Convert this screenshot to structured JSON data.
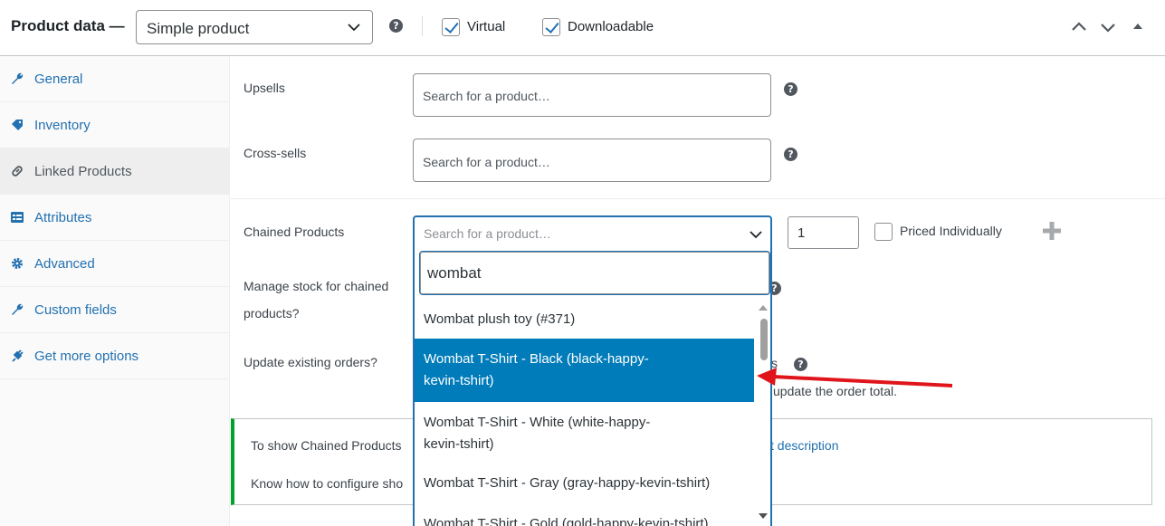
{
  "header": {
    "title": "Product data —",
    "product_type": "Simple product",
    "virtual_label": "Virtual",
    "virtual_checked": true,
    "downloadable_label": "Downloadable",
    "downloadable_checked": true,
    "help_glyph": "?"
  },
  "sidebar": {
    "items": [
      {
        "label": "General",
        "icon": "wrench-icon"
      },
      {
        "label": "Inventory",
        "icon": "tag-icon"
      },
      {
        "label": "Linked Products",
        "icon": "link-icon",
        "active": true
      },
      {
        "label": "Attributes",
        "icon": "list-icon"
      },
      {
        "label": "Advanced",
        "icon": "gear-icon"
      },
      {
        "label": "Custom fields",
        "icon": "wrench-icon"
      },
      {
        "label": "Get more options",
        "icon": "plugin-icon"
      }
    ]
  },
  "main": {
    "upsells_label": "Upsells",
    "upsells_placeholder": "Search for a product…",
    "crosssells_label": "Cross-sells",
    "crosssells_placeholder": "Search for a product…",
    "chained_label": "Chained Products",
    "chained_placeholder": "Search for a product…",
    "quantity": "1",
    "priced_individually_label": "Priced Individually",
    "manage_stock_label_1": "Manage stock for chained",
    "manage_stock_label_2": "products?",
    "update_orders_label": "Update existing orders?",
    "update_orders_cut": "s",
    "order_total_note": "update the order total.",
    "notice_line1": "To show Chained Products",
    "notice_link": "ct description",
    "notice_line2": "Know how to configure sho"
  },
  "dropdown": {
    "search_value": "wombat",
    "options": [
      {
        "label": "Wombat plush toy (#371)"
      },
      {
        "label": "Wombat T-Shirt - Black (black-happy-\nkevin-tshirt)",
        "highlighted": true
      },
      {
        "label": "Wombat T-Shirt - White (white-happy-\nkevin-tshirt)"
      },
      {
        "label": "Wombat T-Shirt - Gray (gray-happy-kevin-tshirt)"
      },
      {
        "label": "Wombat T-Shirt - Gold (gold-happy-kevin-tshirt)"
      }
    ]
  },
  "colors": {
    "accent": "#2271b1",
    "highlight": "#007cba",
    "notice_border": "#00a32a",
    "arrow": "#e0151b"
  }
}
